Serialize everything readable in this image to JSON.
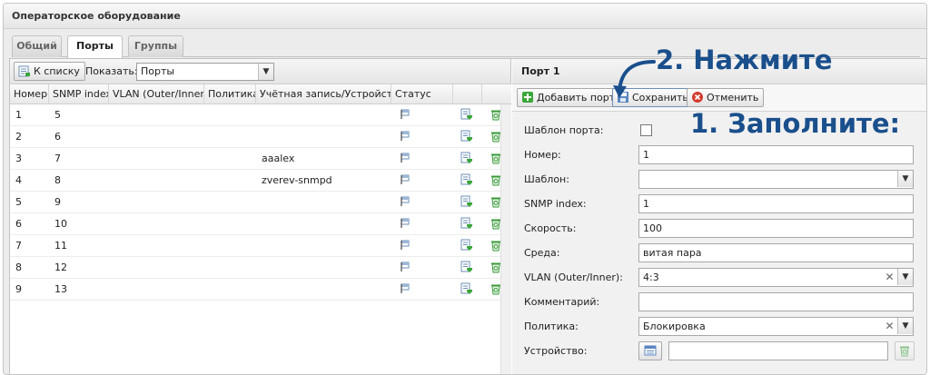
{
  "window": {
    "title": "Операторское оборудование"
  },
  "tabs": [
    {
      "label": "Общий"
    },
    {
      "label": "Порты"
    },
    {
      "label": "Группы"
    }
  ],
  "list_toolbar": {
    "back_label": "К списку",
    "show_label": "Показать:",
    "show_value": "Порты"
  },
  "table": {
    "columns": [
      "Номер",
      "SNMP index",
      "VLAN (Outer/Inner)",
      "Политика",
      "Учётная запись/Устройство",
      "Статус"
    ],
    "rows": [
      {
        "num": "1",
        "snmp": "5",
        "vlan": "",
        "policy": "",
        "account": ""
      },
      {
        "num": "2",
        "snmp": "6",
        "vlan": "",
        "policy": "",
        "account": ""
      },
      {
        "num": "3",
        "snmp": "7",
        "vlan": "",
        "policy": "",
        "account": "aaalex"
      },
      {
        "num": "4",
        "snmp": "8",
        "vlan": "",
        "policy": "",
        "account": "zverev-snmpd"
      },
      {
        "num": "5",
        "snmp": "9",
        "vlan": "",
        "policy": "",
        "account": ""
      },
      {
        "num": "6",
        "snmp": "10",
        "vlan": "",
        "policy": "",
        "account": ""
      },
      {
        "num": "7",
        "snmp": "11",
        "vlan": "",
        "policy": "",
        "account": ""
      },
      {
        "num": "8",
        "snmp": "12",
        "vlan": "",
        "policy": "",
        "account": ""
      },
      {
        "num": "9",
        "snmp": "13",
        "vlan": "",
        "policy": "",
        "account": ""
      }
    ],
    "row_icons": {
      "status": "flag-icon",
      "edit": "edit-icon",
      "delete": "recycle-icon"
    }
  },
  "port_form": {
    "title": "Порт 1",
    "add_label": "Добавить порт",
    "save_label": "Сохранить",
    "cancel_label": "Отменить",
    "fields": {
      "template_port": {
        "label": "Шаблон порта:",
        "checked": false
      },
      "number": {
        "label": "Номер:",
        "value": "1"
      },
      "template": {
        "label": "Шаблон:",
        "value": ""
      },
      "snmp": {
        "label": "SNMP index:",
        "value": "1"
      },
      "speed": {
        "label": "Скорость:",
        "value": "100"
      },
      "media": {
        "label": "Среда:",
        "value": "витая пара"
      },
      "vlan": {
        "label": "VLAN (Outer/Inner):",
        "value": "4:3"
      },
      "comment": {
        "label": "Комментарий:",
        "value": ""
      },
      "policy": {
        "label": "Политика:",
        "value": "Блокировка"
      },
      "device": {
        "label": "Устройство:",
        "value": ""
      }
    }
  },
  "annotations": {
    "step2": "2. Нажмите",
    "step1": "1. Заполните:",
    "color": "#1a4f8c"
  }
}
